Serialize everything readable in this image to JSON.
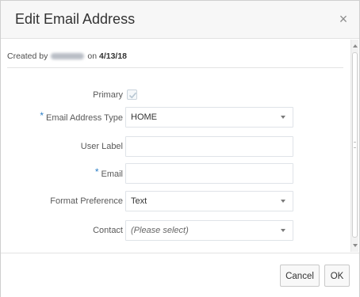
{
  "dialog": {
    "title": "Edit Email Address",
    "close_glyph": "×"
  },
  "created": {
    "prefix": "Created by",
    "middle": "on",
    "date": "4/13/18"
  },
  "form": {
    "primary": {
      "label": "Primary",
      "checked": true
    },
    "email_type": {
      "label": "Email Address Type",
      "value": "HOME",
      "required": true
    },
    "user_label": {
      "label": "User Label",
      "value": ""
    },
    "email": {
      "label": "Email",
      "value": "",
      "required": true
    },
    "format_preference": {
      "label": "Format Preference",
      "value": "Text"
    },
    "contact": {
      "label": "Contact",
      "placeholder": "(Please select)"
    },
    "required_marker": "*"
  },
  "buttons": {
    "cancel": "Cancel",
    "ok": "OK"
  },
  "colors": {
    "required_marker": "#2c7fc7",
    "header_bg": "#f7f7f7",
    "checkmark": "#b8c7d3"
  },
  "icons": {
    "close": "close-icon",
    "dropdown": "chevron-down-icon",
    "check": "checkmark-icon"
  }
}
